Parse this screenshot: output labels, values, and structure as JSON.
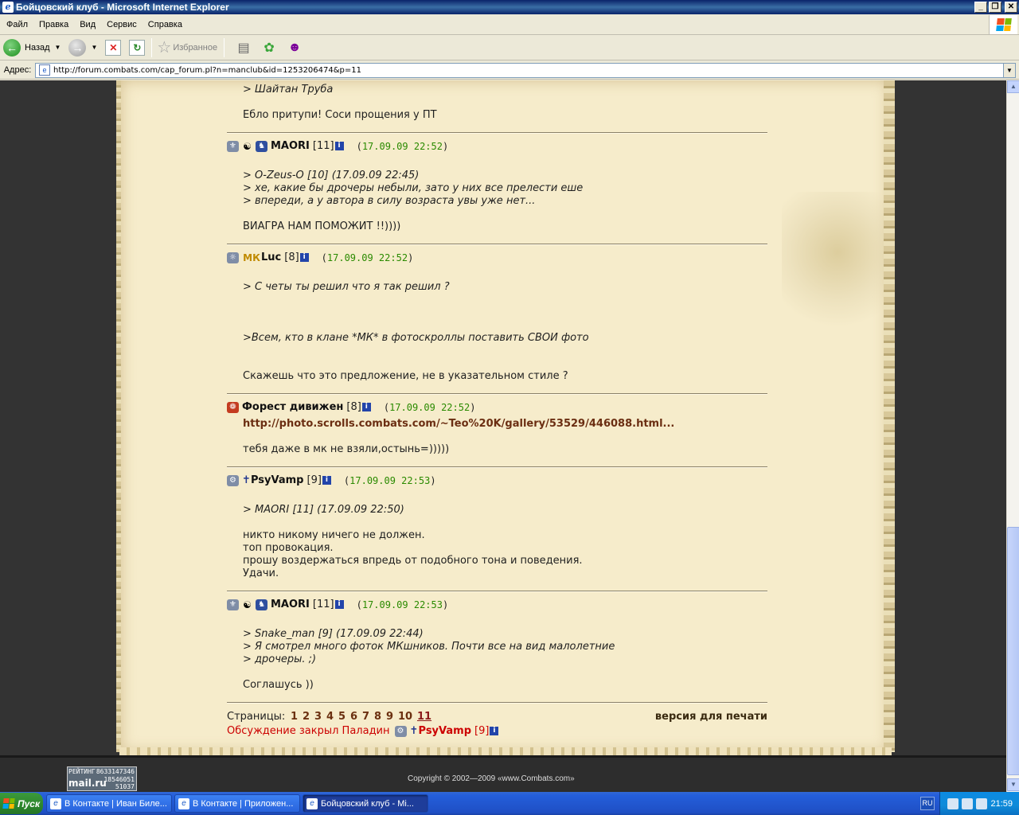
{
  "window": {
    "title": "Бойцовский клуб - Microsoft Internet Explorer"
  },
  "menu": [
    "Файл",
    "Правка",
    "Вид",
    "Сервис",
    "Справка"
  ],
  "toolbar": {
    "back_label": "Назад",
    "favorites_label": "Избранное"
  },
  "address": {
    "label": "Адрес:",
    "url": "http://forum.combats.com/cap_forum.pl?n=manclub&id=1253206474&p=11"
  },
  "content": {
    "top_quote": "> Шайтан Труба",
    "top_text": "Ебло притупи! Соси прощения у ПТ",
    "posts": [
      {
        "nick": "MAORI",
        "level": "[11]",
        "date": "17.09.09 22:52",
        "lines": [
          "> O-Zeus-O [10]   (17.09.09 22:45)",
          "> хе, какие бы дрочеры небыли, зато у них все прелести еше",
          "> впереди, а у автора в силу возраста увы уже нет...",
          "ВИАГРА НАМ ПОМОЖИТ !!))))"
        ]
      },
      {
        "nick": "Luc",
        "mk_badge": "МК",
        "level": "[8]",
        "date": "17.09.09 22:52",
        "lines": [
          "> С четы ты решил что я так решил ?",
          ">Всем, кто в клане *МК* в фотоскроллы поставить СВОИ фото",
          "Скажешь что это предложение, не в указательном стиле ?"
        ]
      },
      {
        "nick": "Форест дивижен",
        "level": "[8]",
        "date": "17.09.09 22:52",
        "link": "http://photo.scrolls.combats.com/~Teo%20K/gallery/53529/446088.html...",
        "lines": [
          "тебя даже в мк не взяли,остынь=)))))"
        ]
      },
      {
        "nick": "PsyVamp",
        "level": "[9]",
        "date": "17.09.09 22:53",
        "lines": [
          "> MAORI [11]   (17.09.09 22:50)",
          "никто никому ничего не должен.",
          "топ провокация.",
          "прошу воздержаться впредь от подобного тона и поведения.",
          "Удачи."
        ]
      },
      {
        "nick": "MAORI",
        "level": "[11]",
        "date": "17.09.09 22:53",
        "lines": [
          "> Snake_man [9]   (17.09.09 22:44)",
          "> Я смотрел много фоток МКшников. Почти все на вид малолетние",
          "> дрочеры. ;)",
          "Соглашусь ))"
        ]
      }
    ],
    "pager": {
      "label": "Страницы:",
      "pages": [
        "1",
        "2",
        "3",
        "4",
        "5",
        "6",
        "7",
        "8",
        "9",
        "10",
        "11"
      ],
      "current": "11",
      "print_label": "версия для печати"
    },
    "closed": {
      "text": "Обсуждение закрыл Паладин",
      "nick": "PsyVamp",
      "level": "[9]"
    }
  },
  "footer": {
    "counter": {
      "label": "РЕЙТИНГ",
      "brand": "mail.ru",
      "v1": "8633147346",
      "v2": "18546051",
      "v3": "51037"
    },
    "copyright": "Copyright © 2002—2009 «www.Combats.com»"
  },
  "taskbar": {
    "start": "Пуск",
    "tasks": [
      "В Контакте | Иван Биле...",
      "В Контакте | Приложен...",
      "Бойцовский клуб - Mi..."
    ],
    "lang": "RU",
    "clock": "21:59"
  }
}
